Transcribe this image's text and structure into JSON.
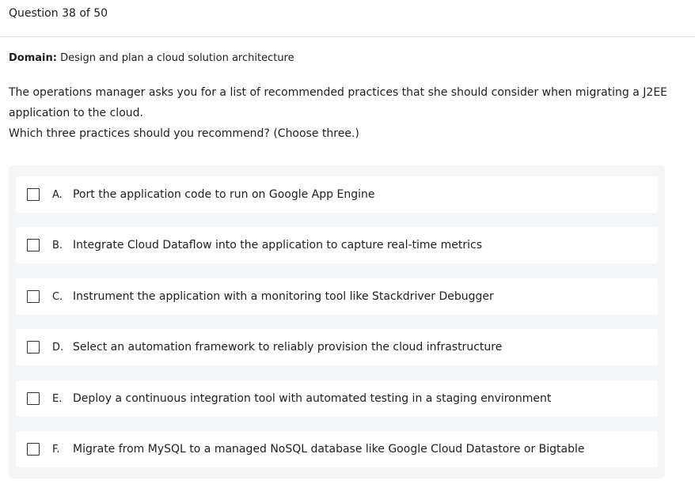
{
  "header": {
    "question_number": "Question 38 of 50"
  },
  "domain": {
    "label": "Domain:",
    "value": "Design and plan a cloud solution architecture"
  },
  "question": {
    "line1": "The operations manager asks you for a list of recommended practices that she should consider when migrating a J2EE application to the cloud.",
    "line2": "Which three practices should you recommend? (Choose three.)"
  },
  "options": [
    {
      "letter": "A.",
      "text": "Port the application code to run on Google App Engine",
      "checked": false
    },
    {
      "letter": "B.",
      "text": "Integrate Cloud Dataflow into the application to capture real-time metrics",
      "checked": false
    },
    {
      "letter": "C.",
      "text": "Instrument the application with a monitoring tool like Stackdriver Debugger",
      "checked": false
    },
    {
      "letter": "D.",
      "text": "Select an automation framework to reliably provision the cloud infrastructure",
      "checked": false
    },
    {
      "letter": "E.",
      "text": "Deploy a continuous integration tool with automated testing in a staging environment",
      "checked": false
    },
    {
      "letter": "F.",
      "text": "Migrate from MySQL to a managed NoSQL database like Google Cloud Datastore or Bigtable",
      "checked": false
    }
  ]
}
